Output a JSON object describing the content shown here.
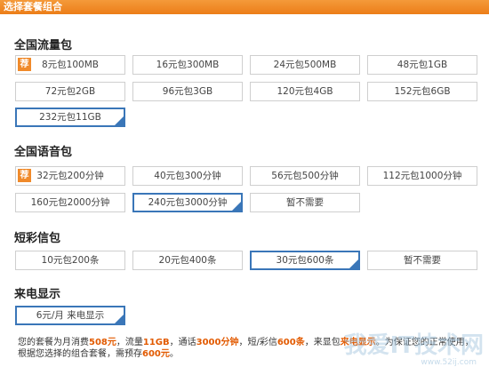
{
  "window": {
    "title": "选择套餐组合"
  },
  "sections": [
    {
      "title": "全国流量包",
      "tag": "荐",
      "options": [
        "8元包100MB",
        "16元包300MB",
        "24元包500MB",
        "48元包1GB",
        "72元包2GB",
        "96元包3GB",
        "120元包4GB",
        "152元包6GB",
        "232元包11GB"
      ],
      "selected": "232元包11GB"
    },
    {
      "title": "全国语音包",
      "tag": "荐",
      "options": [
        "32元包200分钟",
        "40元包300分钟",
        "56元包500分钟",
        "112元包1000分钟",
        "160元包2000分钟",
        "240元包3000分钟",
        "暂不需要"
      ],
      "selected": "240元包3000分钟"
    },
    {
      "title": "短彩信包",
      "options": [
        "10元包200条",
        "20元包400条",
        "30元包600条",
        "暂不需要"
      ],
      "selected": "30元包600条"
    },
    {
      "title": "来电显示",
      "options": [
        "6元/月 来电显示"
      ],
      "selected": "6元/月 来电显示"
    }
  ],
  "summary": {
    "p1": "您的套餐为月消费",
    "monthly": "508元",
    "p2": "，流量",
    "data": "11GB",
    "p3": "，通话",
    "voice": "3000分钟",
    "p4": "，短/彩信",
    "sms": "600条",
    "p5": "，来显包",
    "caller": "来电显示",
    "p6": "。为保证您的正常使用，根据您选择的组合套餐，需预存",
    "deposit": "600元",
    "p7": "。"
  },
  "watermark": {
    "main": "我爱IT技术网",
    "sub": "www.52ij.com"
  }
}
